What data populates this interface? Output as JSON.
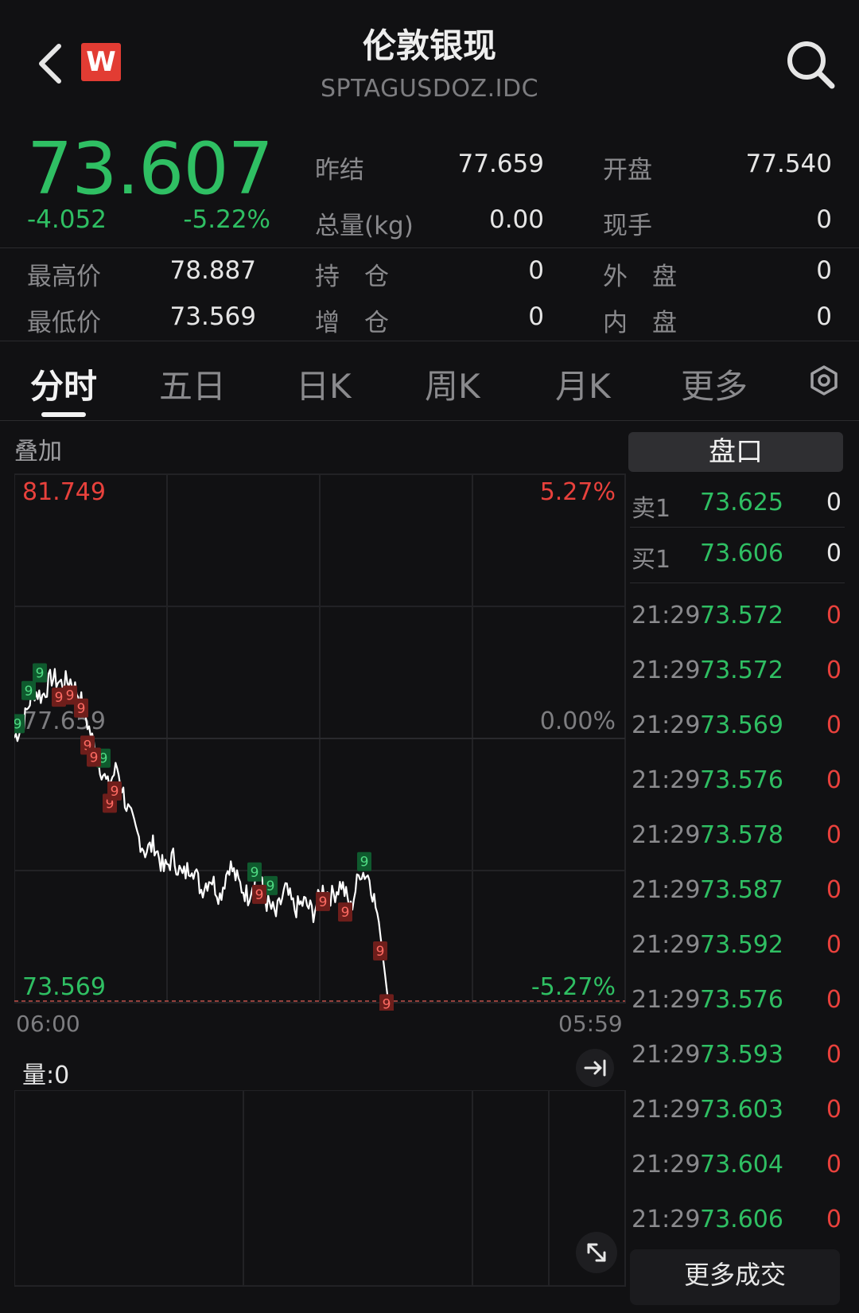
{
  "header": {
    "logo_letter": "W",
    "title": "伦敦银现",
    "symbol": "SPTAGUSDOZ.IDC"
  },
  "quote": {
    "last_price": "73.607",
    "change": "-4.052",
    "change_pct": "-5.22%",
    "fields": [
      {
        "label": "昨结",
        "value": "77.659"
      },
      {
        "label": "开盘",
        "value": "77.540"
      },
      {
        "label": "总量(kg)",
        "value": "0.00"
      },
      {
        "label": "现手",
        "value": "0"
      },
      {
        "label": "最高价",
        "value": "78.887"
      },
      {
        "label": "持　仓",
        "value": "0"
      },
      {
        "label": "外　盘",
        "value": "0"
      },
      {
        "label": "最低价",
        "value": "73.569"
      },
      {
        "label": "增　仓",
        "value": "0"
      },
      {
        "label": "内　盘",
        "value": "0"
      }
    ]
  },
  "tabs": [
    "分时",
    "五日",
    "日K",
    "周K",
    "月K",
    "更多"
  ],
  "active_tab": "分时",
  "chart": {
    "overlay_label": "叠加",
    "top_price": "81.749",
    "top_pct": "5.27%",
    "mid_price": "77.659",
    "mid_pct": "0.00%",
    "bottom_price": "73.569",
    "bottom_pct": "-5.27%",
    "time_start": "06:00",
    "time_end": "05:59",
    "volume_label": "量:0",
    "marker_digit": "9"
  },
  "chart_data": {
    "type": "line",
    "x_range": [
      "06:00",
      "05:59"
    ],
    "ylim": [
      73.569,
      81.749
    ],
    "reference": 77.659,
    "pct_range": [
      "-5.27%",
      "5.27%"
    ],
    "approx_path_y": [
      77.66,
      77.9,
      78.4,
      78.3,
      78.6,
      78.5,
      78.55,
      78.3,
      77.8,
      77.3,
      76.9,
      77.2,
      76.6,
      76.2,
      75.9,
      76.0,
      75.6,
      75.8,
      75.5,
      75.7,
      75.3,
      75.5,
      75.2,
      75.7,
      75.4,
      75.2,
      75.6,
      75.1,
      74.9,
      75.3,
      75.0,
      75.1,
      74.95,
      75.3,
      75.2,
      75.4,
      75.0,
      75.6,
      75.5,
      74.8,
      73.57
    ]
  },
  "order_book": {
    "title": "盘口",
    "asks": [
      {
        "label": "卖1",
        "price": "73.625",
        "qty": "0"
      }
    ],
    "bids": [
      {
        "label": "买1",
        "price": "73.606",
        "qty": "0"
      }
    ]
  },
  "trades": [
    {
      "time": "21:29",
      "price": "73.572",
      "qty": "0"
    },
    {
      "time": "21:29",
      "price": "73.572",
      "qty": "0"
    },
    {
      "time": "21:29",
      "price": "73.569",
      "qty": "0"
    },
    {
      "time": "21:29",
      "price": "73.576",
      "qty": "0"
    },
    {
      "time": "21:29",
      "price": "73.578",
      "qty": "0"
    },
    {
      "time": "21:29",
      "price": "73.587",
      "qty": "0"
    },
    {
      "time": "21:29",
      "price": "73.592",
      "qty": "0"
    },
    {
      "time": "21:29",
      "price": "73.576",
      "qty": "0"
    },
    {
      "time": "21:29",
      "price": "73.593",
      "qty": "0"
    },
    {
      "time": "21:29",
      "price": "73.603",
      "qty": "0"
    },
    {
      "time": "21:29",
      "price": "73.604",
      "qty": "0"
    },
    {
      "time": "21:29",
      "price": "73.606",
      "qty": "0"
    }
  ],
  "more_trades_label": "更多成交",
  "icons": {
    "back": "chevron-left-icon",
    "search": "search-icon",
    "settings": "settings-hexagon-icon",
    "expand": "arrow-to-right-icon",
    "fullscreen": "expand-diagonal-icon"
  },
  "colors": {
    "up": "#e8413c",
    "down": "#2fbf63",
    "price_line": "#ffffff",
    "background": "#111113"
  }
}
